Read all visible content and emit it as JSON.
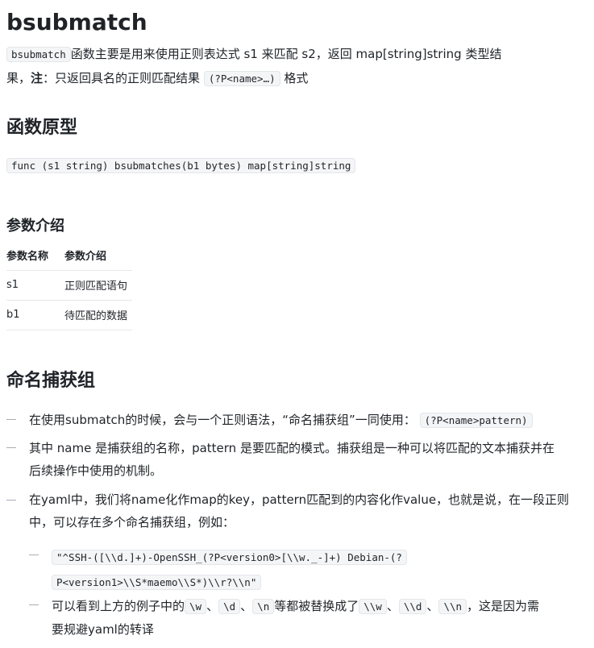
{
  "title": "bsubmatch",
  "intro": {
    "code1": "bsubmatch",
    "text1": "函数主要是用来使用正则表达式 s1 来匹配 s2，返回 map[string]string 类型结",
    "text2a": "果，",
    "note_label": "注",
    "text2b": "：只返回具名的正则匹配结果",
    "code2": "(?P<name>…)",
    "text2c": "格式"
  },
  "prototype": {
    "heading": "函数原型",
    "code": "func (s1 string) bsubmatches(b1 bytes) map[string]string"
  },
  "params": {
    "heading": "参数介绍",
    "columns": [
      "参数名称",
      "参数介绍"
    ],
    "rows": [
      [
        "s1",
        "正则匹配语句"
      ],
      [
        "b1",
        "待匹配的数据"
      ]
    ]
  },
  "named_groups": {
    "heading": "命名捕获组",
    "items": [
      {
        "text": "在使用submatch的时候，会与一个正则语法，“命名捕获组”一同使用：",
        "code": "(?P<name>pattern)"
      },
      {
        "line1": "其中 name 是捕获组的名称，pattern 是要匹配的模式。捕获组是一种可以将匹配的文本捕获并在",
        "line2": "后续操作中使用的机制。"
      },
      {
        "line1": "在yaml中，我们将name化作map的key，pattern匹配到的内容化作value，也就是说，在一段正则",
        "line2": "中，可以存在多个命名捕获组，例如："
      }
    ],
    "sub_items": {
      "example_line1": "\"^SSH-([\\\\d.]+)-OpenSSH_(?P<version0>[\\\\w._-]+) Debian-(?",
      "example_line2": "P<version1>\\\\S*maemo\\\\S*)\\\\r?\\\\n\"",
      "escape_text_a": "可以看到上方的例子中的",
      "code_w": "\\w",
      "sep": "、",
      "code_d": "\\d",
      "code_n": "\\n",
      "escape_text_b": "等都被替换成了",
      "code_ww": "\\\\w",
      "code_dd": "\\\\d",
      "code_nn": "\\\\n",
      "escape_text_c": "，这是因为需",
      "escape_text_d": "要规避yaml的转译"
    }
  }
}
